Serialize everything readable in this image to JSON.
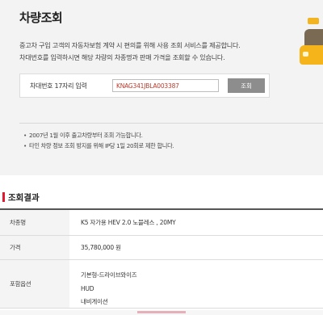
{
  "page": {
    "title": "차량조회",
    "intro_lines": [
      "중고차 구입 고객의 자동차보험 계약 시 편의를 위해 사용 조회 서비스를 제공합니다.",
      "차대번호를 입력하시면 해당 차량의 차종명과 판매 가격을 조회할 수 있습니다."
    ]
  },
  "search": {
    "label": "차대번호 17자리 입력",
    "value": "KNAG341JBLA003387",
    "button_label": "조회"
  },
  "notes": [
    "2007년 1월 이후 출고차량부터 조회 가능합니다.",
    "타인 차량 정보 조회 방지를 위해 IP당 1일 20회로 제한 합니다."
  ],
  "result": {
    "title": "조회결과",
    "rows": {
      "model": {
        "label": "차종명",
        "value": "K5 자가용 HEV 2.0 노블레스 , 20MY"
      },
      "price": {
        "label": "가격",
        "value": "35,780,000 원"
      },
      "options": {
        "label": "포함옵션",
        "values": [
          "기본형-드라이브와이즈",
          "HUD",
          "내비게이션"
        ]
      }
    }
  },
  "colors": {
    "accent": "#e01830",
    "button": "#8d8d8d",
    "input_text": "#c0392b",
    "panel_bg": "#f3f3f3"
  }
}
